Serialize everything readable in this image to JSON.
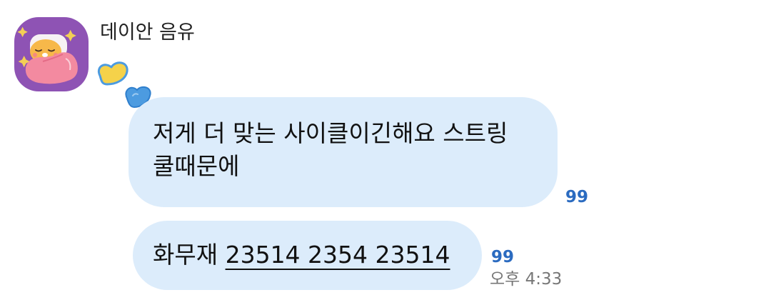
{
  "sender": {
    "name": "데이안 음유",
    "avatar_icon": "sleeping-character-avatar",
    "avatar_bg": "#8e53b4"
  },
  "decoration": {
    "icon": "heart-stickers-icon",
    "colors": [
      "#f5d24a",
      "#4c9be0"
    ]
  },
  "messages": [
    {
      "lines": [
        "저게 더 맞는 사이클이긴해요 스트링",
        "쿨때문에"
      ],
      "unread": "99"
    },
    {
      "prefix": "화무재 ",
      "link": "23514 2354 23514",
      "unread": "99",
      "time": "오후 4:33"
    }
  ],
  "colors": {
    "bubble": "#dcecfb",
    "unread": "#2b6bc0",
    "timestamp": "#777777"
  }
}
